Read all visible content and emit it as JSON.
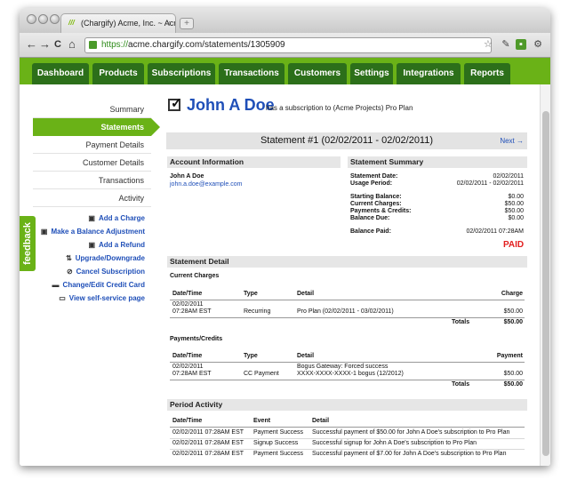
{
  "browser": {
    "tab_title": "(Chargify) Acme, Inc. ~ Acme",
    "tab_close": "×",
    "new_tab": "+",
    "url_scheme": "https://",
    "url_rest": "acme.chargify.com/statements/1305909",
    "back": "←",
    "forward": "→",
    "reload": "C",
    "home": "⌂"
  },
  "nav": {
    "tabs": [
      "Dashboard",
      "Products",
      "Subscriptions",
      "Transactions",
      "Customers",
      "Settings",
      "Integrations",
      "Reports"
    ]
  },
  "sidebar": {
    "links": [
      "Summary",
      "Statements",
      "Payment Details",
      "Customer Details",
      "Transactions",
      "Activity"
    ],
    "active_index": 1,
    "actions": [
      {
        "label": "Add a Charge",
        "icon": "charge-icon",
        "glyph": "▣"
      },
      {
        "label": "Make a Balance Adjustment",
        "icon": "adjust-icon",
        "glyph": "▣"
      },
      {
        "label": "Add a Refund",
        "icon": "refund-icon",
        "glyph": "▣"
      },
      {
        "label": "Upgrade/Downgrade",
        "icon": "updown-icon",
        "glyph": "⇅"
      },
      {
        "label": "Cancel Subscription",
        "icon": "cancel-icon",
        "glyph": "⊘"
      },
      {
        "label": "Change/Edit Credit Card",
        "icon": "card-icon",
        "glyph": "▬"
      },
      {
        "label": "View self-service page",
        "icon": "monitor-icon",
        "glyph": "▭"
      }
    ],
    "feedback": "feedback"
  },
  "header": {
    "customer_name": "John A Doe",
    "subscription_text": "has a subscription to (Acme Projects) Pro Plan"
  },
  "statement": {
    "title": "Statement #1 (02/02/2011 - 02/02/2011)",
    "next": "Next →"
  },
  "account": {
    "heading": "Account Information",
    "name": "John A Doe",
    "email": "john.a.doe@example.com"
  },
  "summary": {
    "heading": "Statement Summary",
    "rows": [
      {
        "label": "Statement Date:",
        "value": "02/02/2011"
      },
      {
        "label": "Usage Period:",
        "value": "02/02/2011 - 02/02/2011"
      },
      {
        "label": "Starting Balance:",
        "value": "$0.00"
      },
      {
        "label": "Current Charges:",
        "value": "$50.00"
      },
      {
        "label": "Payments & Credits:",
        "value": "$50.00"
      },
      {
        "label": "Balance Due:",
        "value": "$0.00"
      },
      {
        "label": "Balance Paid:",
        "value": "02/02/2011 07:28AM"
      }
    ],
    "status": "PAID"
  },
  "detail": {
    "heading": "Statement Detail",
    "charges": {
      "title": "Current Charges",
      "headers": [
        "Date/Time",
        "Type",
        "Detail",
        "Charge"
      ],
      "row": {
        "date1": "02/02/2011",
        "date2": "07:28AM EST",
        "type": "Recurring",
        "detail": "Pro Plan (02/02/2011 - 03/02/2011)",
        "amount": "$50.00"
      },
      "totals_label": "Totals",
      "totals_value": "$50.00"
    },
    "payments": {
      "title": "Payments/Credits",
      "headers": [
        "Date/Time",
        "Type",
        "Detail",
        "Payment"
      ],
      "row": {
        "date1": "02/02/2011",
        "date2": "07:28AM EST",
        "type": "CC Payment",
        "detail1": "Bogus Gateway: Forced success",
        "detail2": "XXXX-XXXX-XXXX-1 bogus (12/2012)",
        "amount": "$50.00"
      },
      "totals_label": "Totals",
      "totals_value": "$50.00"
    }
  },
  "activity": {
    "heading": "Period Activity",
    "headers": [
      "Date/Time",
      "Event",
      "Detail"
    ],
    "rows": [
      {
        "date": "02/02/2011 07:28AM EST",
        "event": "Payment Success",
        "detail": "Successful payment of $50.00 for John A Doe's subscription to Pro Plan"
      },
      {
        "date": "02/02/2011 07:28AM EST",
        "event": "Signup Success",
        "detail": "Successful signup for John A Doe's subscription to Pro Plan"
      },
      {
        "date": "02/02/2011 07:28AM EST",
        "event": "Payment Success",
        "detail": "Successful payment of $7.00 for John A Doe's subscription to Pro Plan"
      }
    ]
  }
}
